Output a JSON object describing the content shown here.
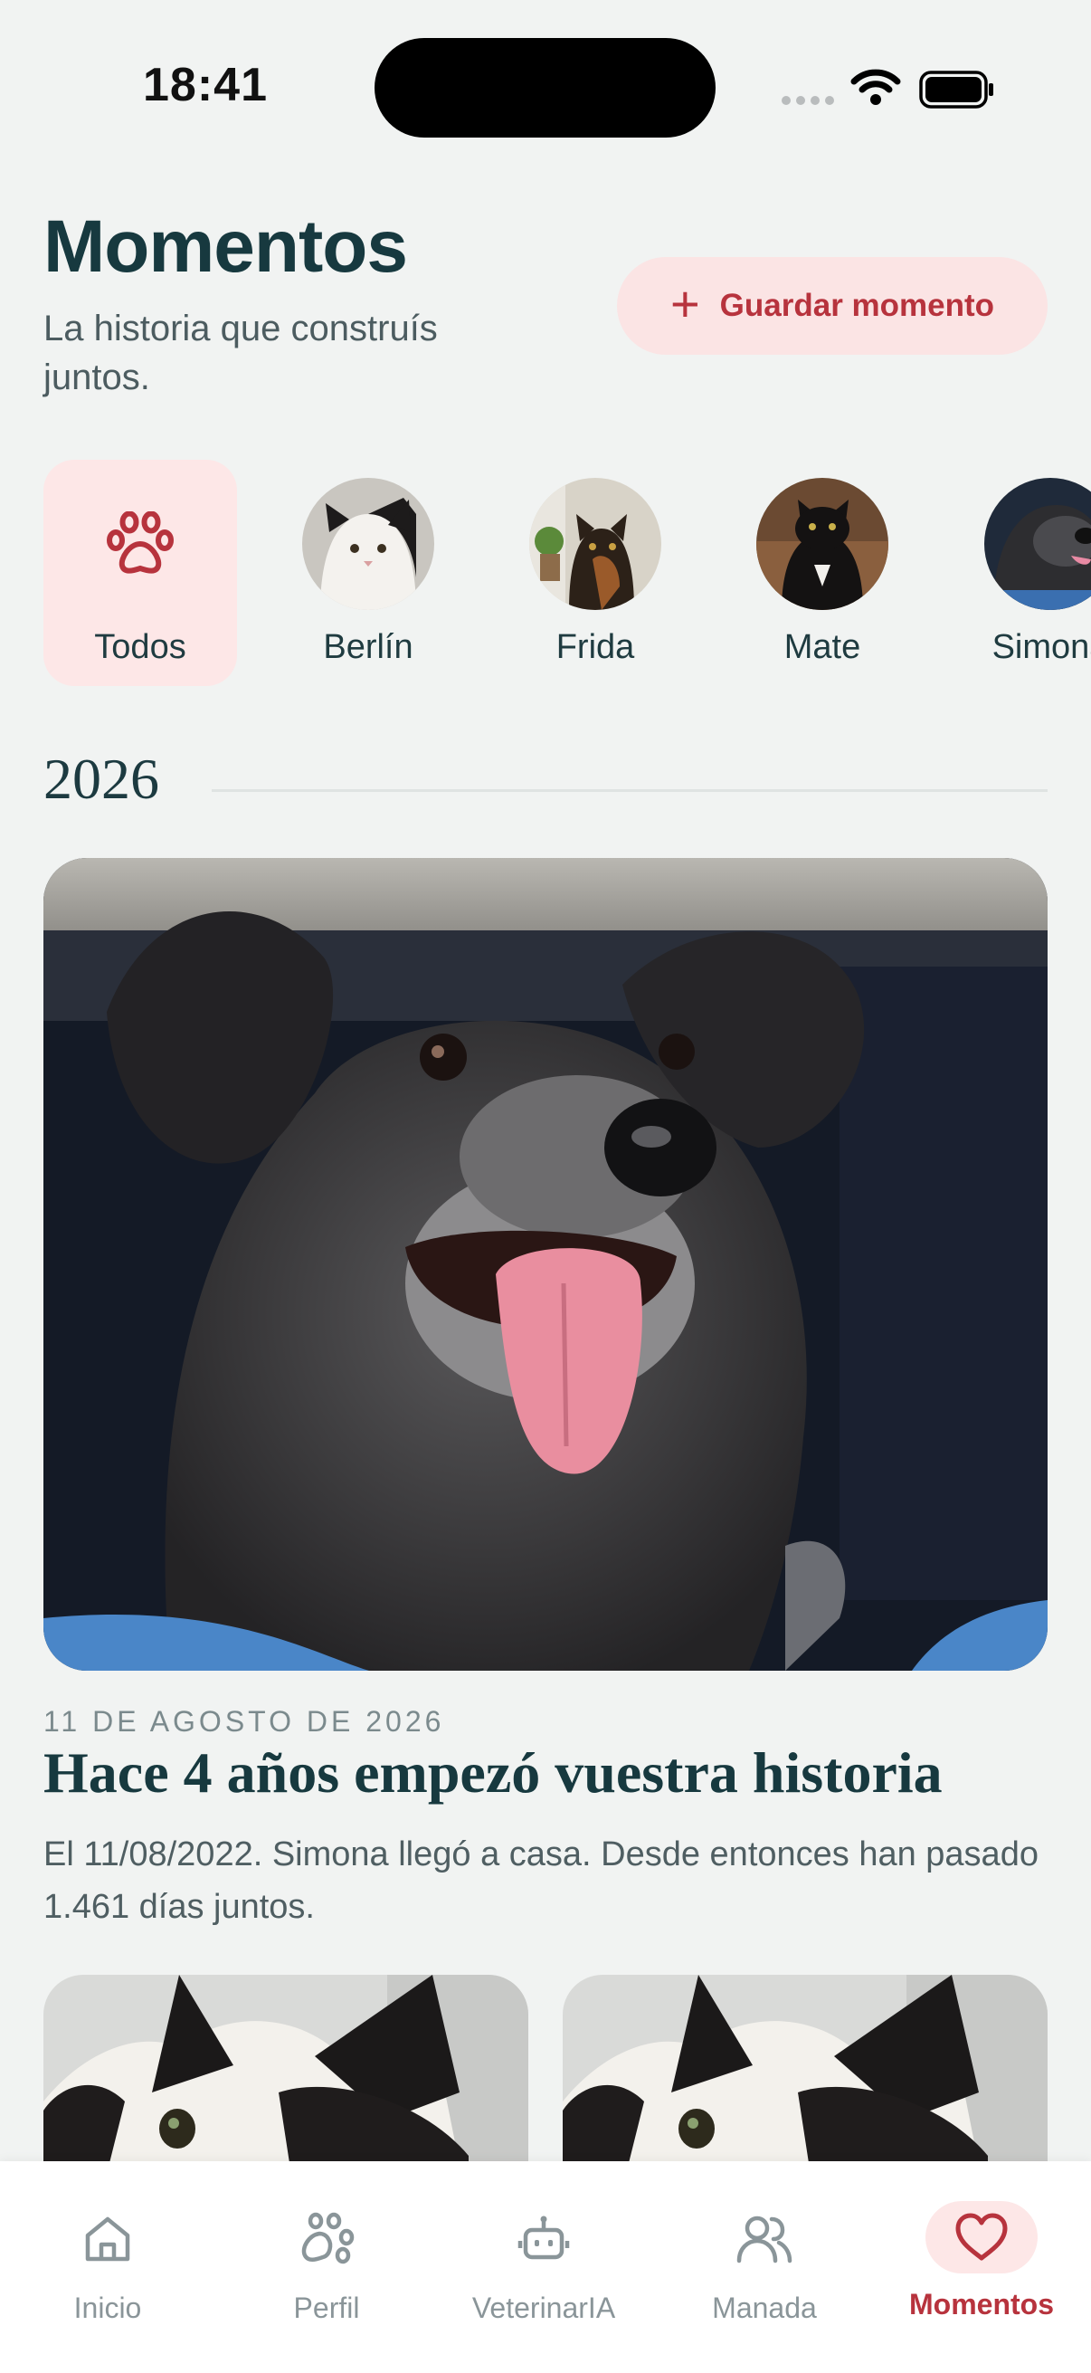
{
  "status_bar": {
    "time": "18:41"
  },
  "header": {
    "title": "Momentos",
    "subtitle": "La historia que construís juntos.",
    "save_button_label": "Guardar momento"
  },
  "pet_filter": [
    {
      "name": "Todos",
      "icon": "paw-icon",
      "selected": true
    },
    {
      "name": "Berlín",
      "icon": "cat-photo",
      "selected": false
    },
    {
      "name": "Frida",
      "icon": "cat-photo",
      "selected": false
    },
    {
      "name": "Mate",
      "icon": "cat-photo",
      "selected": false
    },
    {
      "name": "Simona",
      "icon": "dog-photo",
      "selected": false
    }
  ],
  "timeline": {
    "year": "2026",
    "moment": {
      "date": "11 DE AGOSTO DE 2026",
      "title": "Hace 4 años empezó vuestra historia",
      "description": "El 11/08/2022. Simona llegó a casa. Desde entonces han pasado 1.461 días juntos."
    }
  },
  "bottom_nav": [
    {
      "label": "Inicio",
      "icon": "home-icon",
      "active": false
    },
    {
      "label": "Perfil",
      "icon": "paw-outline-icon",
      "active": false
    },
    {
      "label": "VeterinarIA",
      "icon": "robot-icon",
      "active": false
    },
    {
      "label": "Manada",
      "icon": "group-icon",
      "active": false
    },
    {
      "label": "Momentos",
      "icon": "heart-icon",
      "active": true
    }
  ],
  "colors": {
    "background": "#f1f3f2",
    "title": "#17393f",
    "accent": "#b7333d",
    "accent_bg": "#fde7e7"
  }
}
